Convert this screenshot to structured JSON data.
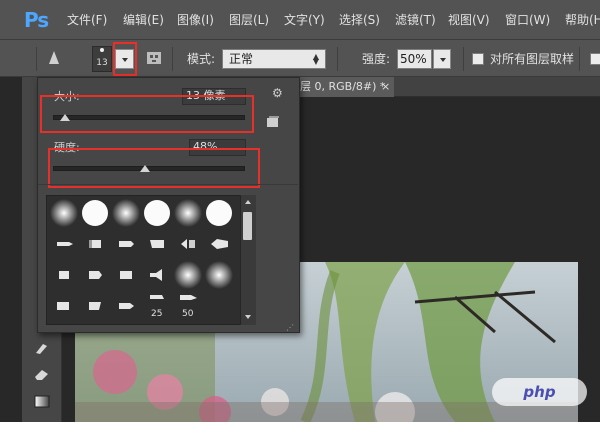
{
  "app": {
    "logo": "Ps"
  },
  "menu": [
    "文件(F)",
    "编辑(E)",
    "图像(I)",
    "图层(L)",
    "文字(Y)",
    "选择(S)",
    "滤镜(T)",
    "视图(V)",
    "窗口(W)",
    "帮助(H)"
  ],
  "options_bar": {
    "brush_size": "13",
    "mode_label": "模式:",
    "mode_value": "正常",
    "strength_label": "强度:",
    "strength_value": "50%",
    "sample_all_layers": "对所有图层取样"
  },
  "document_tab": {
    "title": "层 0, RGB/8#) *",
    "close": "×"
  },
  "brush_panel": {
    "size_label": "大小:",
    "size_value": "13 像素",
    "size_level_percent": 6,
    "hardness_label": "硬度:",
    "hardness_value": "48%",
    "hardness_level_percent": 48,
    "preset_numbers": [
      "25",
      "50"
    ]
  },
  "watermark": "php",
  "colors": {
    "highlight": "#e8302b",
    "ps_blue": "#4da6ff"
  }
}
